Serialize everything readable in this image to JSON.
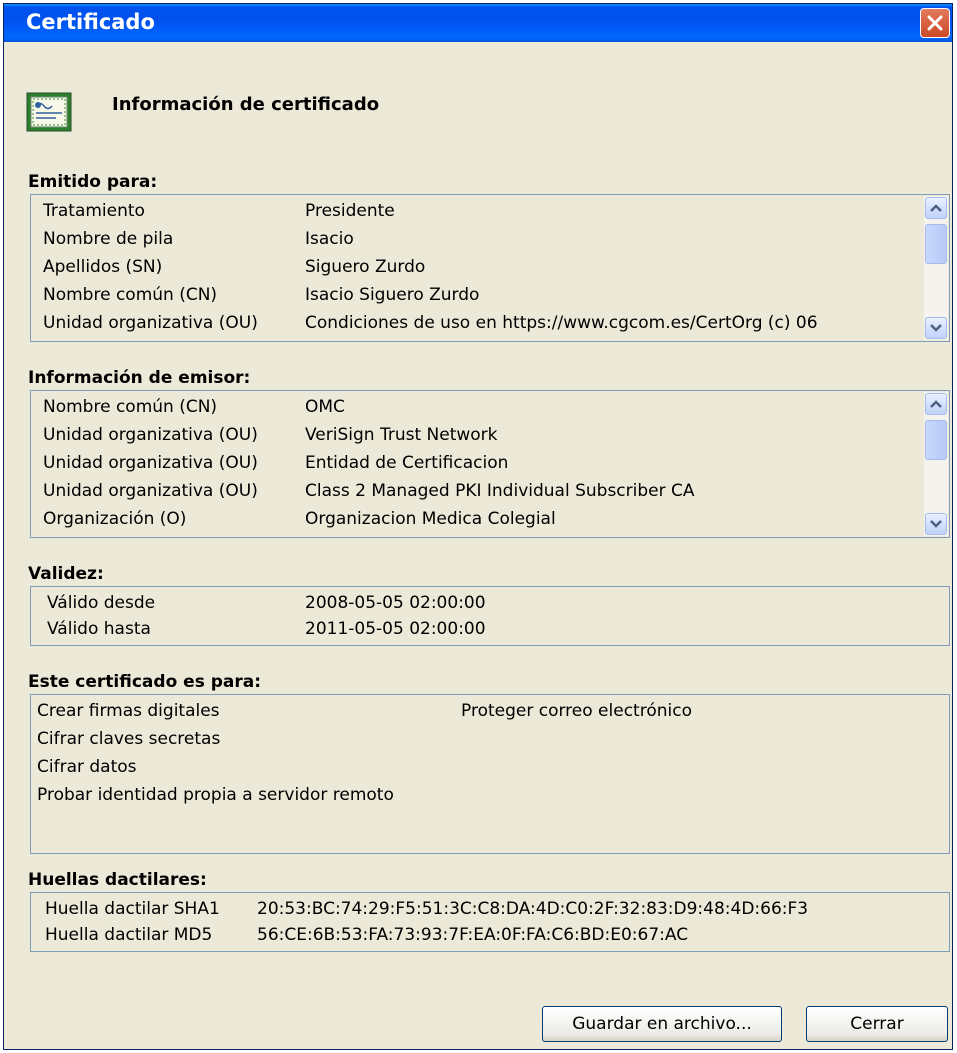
{
  "window": {
    "title": "Certificado"
  },
  "header": {
    "title": "Información de certificado",
    "icon": "certificate-icon"
  },
  "issued_to": {
    "label": "Emitido para:",
    "rows": [
      {
        "k": "Tratamiento",
        "v": "Presidente"
      },
      {
        "k": "Nombre de pila",
        "v": "Isacio"
      },
      {
        "k": "Apellidos (SN)",
        "v": "Siguero Zurdo"
      },
      {
        "k": "Nombre común (CN)",
        "v": "Isacio Siguero Zurdo"
      },
      {
        "k": "Unidad organizativa (OU)",
        "v": "Condiciones de uso en https://www.cgcom.es/CertOrg (c) 06"
      }
    ]
  },
  "issuer": {
    "label": "Información de emisor:",
    "rows": [
      {
        "k": "Nombre común (CN)",
        "v": "OMC"
      },
      {
        "k": "Unidad organizativa (OU)",
        "v": "VeriSign Trust Network"
      },
      {
        "k": "Unidad organizativa (OU)",
        "v": "Entidad de Certificacion"
      },
      {
        "k": "Unidad organizativa (OU)",
        "v": "Class 2 Managed PKI Individual Subscriber CA"
      },
      {
        "k": "Organización (O)",
        "v": "Organizacion Medica Colegial"
      }
    ]
  },
  "validity": {
    "label": "Validez:",
    "rows": [
      {
        "k": "Válido desde",
        "v": "2008-05-05 02:00:00"
      },
      {
        "k": "Válido hasta",
        "v": "2011-05-05 02:00:00"
      }
    ]
  },
  "purposes": {
    "label": "Este certificado es para:",
    "col1": [
      "Crear firmas digitales",
      "Cifrar claves secretas",
      "Cifrar datos",
      "Probar identidad propia a servidor remoto"
    ],
    "col2": [
      "Proteger correo electrónico"
    ]
  },
  "fingerprints": {
    "label": "Huellas dactilares:",
    "rows": [
      {
        "k": "Huella dactilar SHA1",
        "v": "20:53:BC:74:29:F5:51:3C:C8:DA:4D:C0:2F:32:83:D9:48:4D:66:F3"
      },
      {
        "k": "Huella dactilar MD5",
        "v": "56:CE:6B:53:FA:73:93:7F:EA:0F:FA:C6:BD:E0:67:AC"
      }
    ]
  },
  "buttons": {
    "save": "Guardar en archivo...",
    "close": "Cerrar"
  }
}
